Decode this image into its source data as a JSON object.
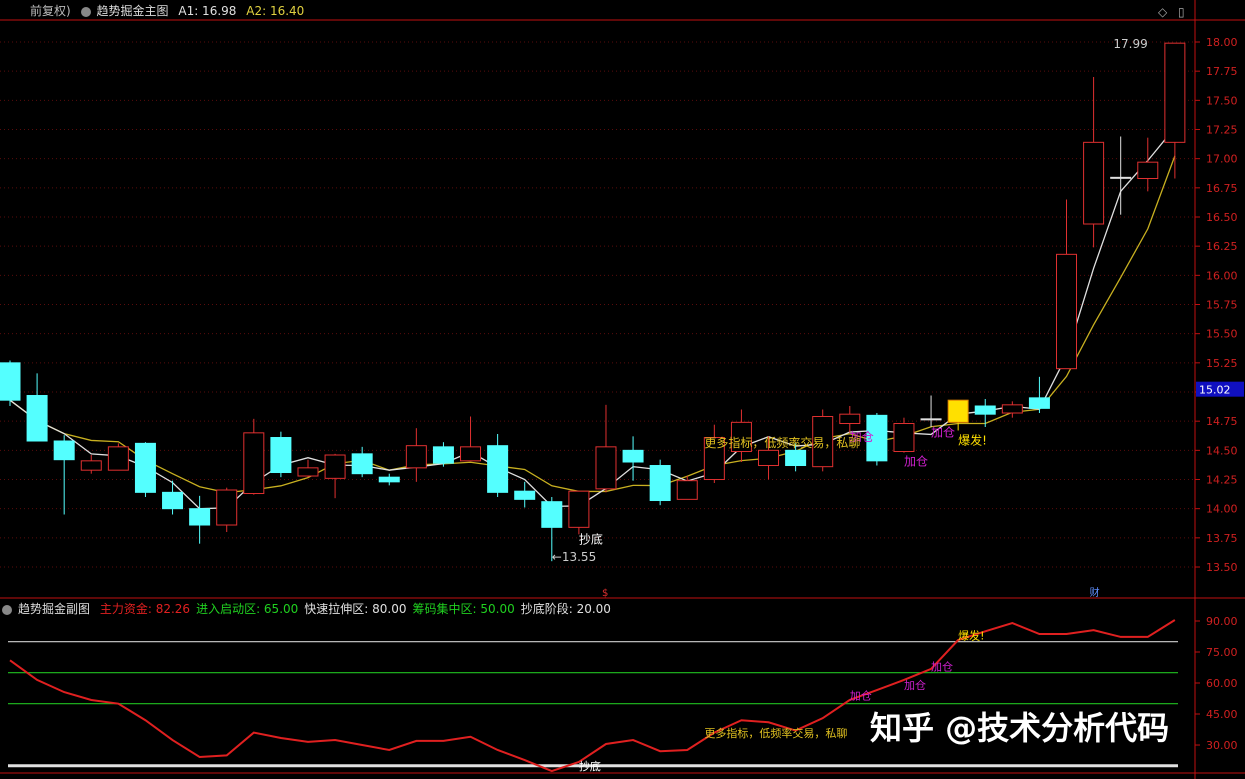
{
  "header": {
    "adjust": "前复权)",
    "indicator": "趋势掘金主图",
    "a1": "A1: 16.98",
    "a2": "A2: 16.40"
  },
  "sub_header": {
    "indicator": "趋势掘金副图",
    "items": [
      {
        "label": "主力资金: 82.26",
        "color": "#e02020"
      },
      {
        "label": "进入启动区: 65.00",
        "color": "#20d020"
      },
      {
        "label": "快速拉伸区: 80.00",
        "color": "#e0e0e0"
      },
      {
        "label": "筹码集中区: 50.00",
        "color": "#20d020"
      },
      {
        "label": "抄底阶段: 20.00",
        "color": "#e0e0e0"
      }
    ]
  },
  "watermark": "知乎 @技术分析代码",
  "colors": {
    "up": "#e03030",
    "down": "#54ffff",
    "axis": "#c01010",
    "ma_fast": "#e0e0e0",
    "ma_slow": "#c8b020",
    "highlight": "#ffe000",
    "annotation_buy": "#d020d0",
    "annotation_burst": "#ffe000",
    "current_price_bg": "#1010c0"
  },
  "chart_data": [
    {
      "type": "candlestick",
      "ylim": [
        13.4,
        18.05
      ],
      "yticks": [
        "18.00",
        "17.75",
        "17.50",
        "17.25",
        "17.00",
        "16.75",
        "16.50",
        "16.25",
        "16.00",
        "15.75",
        "15.50",
        "15.25",
        "15.00",
        "14.75",
        "14.50",
        "14.25",
        "14.00",
        "13.75",
        "13.50"
      ],
      "current_price": "15.02",
      "ohlc": [
        [
          15.25,
          15.27,
          14.88,
          14.93
        ],
        [
          14.97,
          15.16,
          14.58,
          14.58
        ],
        [
          14.58,
          14.63,
          13.95,
          14.42
        ],
        [
          14.33,
          14.46,
          14.3,
          14.41
        ],
        [
          14.33,
          14.56,
          14.33,
          14.53
        ],
        [
          14.56,
          14.57,
          14.1,
          14.14
        ],
        [
          14.14,
          14.24,
          13.95,
          14.0
        ],
        [
          14.0,
          14.11,
          13.7,
          13.86
        ],
        [
          13.86,
          14.18,
          13.8,
          14.16
        ],
        [
          14.13,
          14.77,
          14.12,
          14.65
        ],
        [
          14.61,
          14.66,
          14.27,
          14.31
        ],
        [
          14.28,
          14.42,
          14.27,
          14.35
        ],
        [
          14.26,
          14.47,
          14.09,
          14.46
        ],
        [
          14.47,
          14.53,
          14.27,
          14.3
        ],
        [
          14.27,
          14.3,
          14.2,
          14.23
        ],
        [
          14.35,
          14.69,
          14.23,
          14.54
        ],
        [
          14.53,
          14.57,
          14.36,
          14.39
        ],
        [
          14.41,
          14.79,
          14.42,
          14.53
        ],
        [
          14.54,
          14.64,
          14.1,
          14.14
        ],
        [
          14.15,
          14.23,
          14.01,
          14.08
        ],
        [
          14.06,
          14.1,
          13.55,
          13.84
        ],
        [
          13.84,
          14.15,
          13.78,
          14.15
        ],
        [
          14.17,
          14.89,
          14.14,
          14.53
        ],
        [
          14.5,
          14.62,
          14.24,
          14.4
        ],
        [
          14.37,
          14.42,
          14.03,
          14.07
        ],
        [
          14.08,
          14.28,
          14.08,
          14.24
        ],
        [
          14.25,
          14.72,
          14.22,
          14.61
        ],
        [
          14.49,
          14.85,
          14.4,
          14.74
        ],
        [
          14.37,
          14.62,
          14.25,
          14.5
        ],
        [
          14.5,
          14.56,
          14.32,
          14.37
        ],
        [
          14.36,
          14.85,
          14.32,
          14.79
        ],
        [
          14.73,
          14.88,
          14.65,
          14.81
        ],
        [
          14.8,
          14.82,
          14.37,
          14.41
        ],
        [
          14.49,
          14.78,
          14.48,
          14.73
        ],
        [
          14.77,
          14.97,
          14.7,
          14.77
        ],
        [
          14.74,
          14.93,
          14.67,
          14.93
        ],
        [
          14.88,
          14.94,
          14.7,
          14.81
        ],
        [
          14.82,
          14.92,
          14.78,
          14.89
        ],
        [
          14.95,
          15.13,
          14.82,
          14.86
        ],
        [
          15.2,
          16.65,
          15.2,
          16.18
        ],
        [
          16.44,
          17.7,
          16.24,
          17.14
        ],
        [
          16.84,
          17.19,
          16.52,
          16.84
        ],
        [
          16.83,
          17.18,
          16.72,
          16.97
        ],
        [
          17.14,
          17.99,
          16.83,
          17.99
        ]
      ],
      "highlight_index": 35,
      "annotations": [
        {
          "text": "抄底",
          "index": 21,
          "price": 13.7,
          "color": "#ffffff"
        },
        {
          "text": "←13.55",
          "index": 20,
          "price": 13.55,
          "color": "#cccccc"
        },
        {
          "text": "17.99",
          "index": 42,
          "price": 17.95,
          "color": "#cccccc"
        },
        {
          "text": "加仓",
          "index": 31,
          "price": 14.58,
          "color": "#d020d0"
        },
        {
          "text": "加仓",
          "index": 33,
          "price": 14.37,
          "color": "#d020d0"
        },
        {
          "text": "加仓",
          "index": 34,
          "price": 14.62,
          "color": "#d020d0"
        },
        {
          "text": "爆发!",
          "index": 35,
          "price": 14.55,
          "color": "#ffe000"
        },
        {
          "text": "更多指标，低频率交易，私聊",
          "index": 26,
          "price": 14.53,
          "color": "#e0c020"
        }
      ],
      "markers": [
        {
          "text": "$",
          "index": 22,
          "color": "#e03030"
        },
        {
          "text": "财",
          "index": 40,
          "color": "#6090ff"
        }
      ]
    },
    {
      "type": "line",
      "ylim": [
        17,
        93
      ],
      "yticks": [
        "90.00",
        "75.00",
        "60.00",
        "45.00",
        "30.00"
      ],
      "series": [
        {
          "name": "主力资金",
          "color": "#e02020",
          "values": [
            71,
            61.5,
            55.6,
            51.8,
            50,
            42,
            32.4,
            24.2,
            25,
            36,
            33.4,
            31.5,
            32.4,
            30,
            27.6,
            32,
            32,
            34,
            27.6,
            22.7,
            17.4,
            21.8,
            30.5,
            32.4,
            27,
            27.6,
            36,
            42,
            41,
            37,
            43,
            51.8,
            56.6,
            61.5,
            66.8,
            80.8,
            85,
            89,
            83.7,
            83.7,
            85.6,
            82.3,
            82.3,
            90.5
          ]
        }
      ],
      "levels": [
        {
          "value": 80,
          "color": "#d0d0d0"
        },
        {
          "value": 65,
          "color": "#20c020"
        },
        {
          "value": 50,
          "color": "#20c020"
        },
        {
          "value": 20,
          "color": "#e0e0e0"
        }
      ],
      "annotations": [
        {
          "text": "抄底",
          "index": 21,
          "value": 18,
          "color": "#ffffff"
        },
        {
          "text": "加仓",
          "index": 31,
          "value": 52,
          "color": "#d020d0"
        },
        {
          "text": "加仓",
          "index": 33,
          "value": 57,
          "color": "#d020d0"
        },
        {
          "text": "加仓",
          "index": 34,
          "value": 66,
          "color": "#d020d0"
        },
        {
          "text": "爆发!",
          "index": 35,
          "value": 81,
          "color": "#ffe000"
        },
        {
          "text": "更多指标，低频率交易，私聊",
          "index": 26,
          "value": 34,
          "color": "#e0c020"
        }
      ]
    }
  ]
}
